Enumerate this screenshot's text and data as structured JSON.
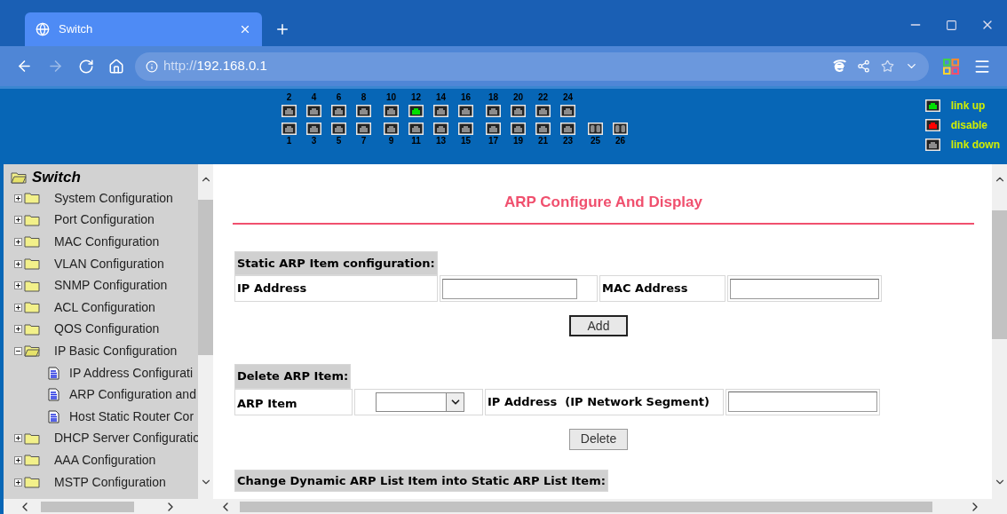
{
  "browser": {
    "tab": {
      "title": "Switch"
    },
    "url": {
      "scheme": "http://",
      "host": "192.168.0.1"
    }
  },
  "ports": {
    "groups": [
      {
        "kind": "copper",
        "columns": [
          {
            "top": {
              "label": "2",
              "link_up": false
            },
            "bottom": {
              "label": "1",
              "link_up": false
            }
          },
          {
            "top": {
              "label": "4",
              "link_up": false
            },
            "bottom": {
              "label": "3",
              "link_up": false
            }
          },
          {
            "top": {
              "label": "6",
              "link_up": false
            },
            "bottom": {
              "label": "5",
              "link_up": false
            }
          },
          {
            "top": {
              "label": "8",
              "link_up": false
            },
            "bottom": {
              "label": "7",
              "link_up": false
            }
          }
        ]
      },
      {
        "kind": "copper",
        "columns": [
          {
            "top": {
              "label": "10",
              "link_up": false
            },
            "bottom": {
              "label": "9",
              "link_up": false
            }
          },
          {
            "top": {
              "label": "12",
              "link_up": true
            },
            "bottom": {
              "label": "11",
              "link_up": false
            }
          },
          {
            "top": {
              "label": "14",
              "link_up": false
            },
            "bottom": {
              "label": "13",
              "link_up": false
            }
          },
          {
            "top": {
              "label": "16",
              "link_up": false
            },
            "bottom": {
              "label": "15",
              "link_up": false
            }
          }
        ]
      },
      {
        "kind": "copper",
        "columns": [
          {
            "top": {
              "label": "18",
              "link_up": false
            },
            "bottom": {
              "label": "17",
              "link_up": false
            }
          },
          {
            "top": {
              "label": "20",
              "link_up": false
            },
            "bottom": {
              "label": "19",
              "link_up": false
            }
          },
          {
            "top": {
              "label": "22",
              "link_up": false
            },
            "bottom": {
              "label": "21",
              "link_up": false
            }
          },
          {
            "top": {
              "label": "24",
              "link_up": false
            },
            "bottom": {
              "label": "23",
              "link_up": false
            }
          }
        ]
      },
      {
        "kind": "fiber",
        "columns": [
          {
            "bottom": {
              "label": "25",
              "link_up": false
            }
          },
          {
            "bottom": {
              "label": "26",
              "link_up": false
            }
          }
        ]
      }
    ],
    "legend": [
      {
        "color": "#00e000",
        "label": "link up"
      },
      {
        "color": "#ff0000",
        "label": "disable"
      },
      {
        "color": "#8c8c8c",
        "label": "link down"
      }
    ]
  },
  "sidebar": {
    "root": "Switch",
    "items": [
      {
        "label": "System Configuration",
        "expanded": false
      },
      {
        "label": "Port Configuration",
        "expanded": false
      },
      {
        "label": "MAC Configuration",
        "expanded": false
      },
      {
        "label": "VLAN Configuration",
        "expanded": false
      },
      {
        "label": "SNMP Configuration",
        "expanded": false
      },
      {
        "label": "ACL Configuration",
        "expanded": false
      },
      {
        "label": "QOS Configuration",
        "expanded": false
      },
      {
        "label": "IP Basic Configuration",
        "expanded": true,
        "children": [
          {
            "label": "IP Address Configurati"
          },
          {
            "label": "ARP Configuration and"
          },
          {
            "label": "Host Static Router Cor"
          }
        ]
      },
      {
        "label": "DHCP Server Configuratio",
        "expanded": false
      },
      {
        "label": "AAA Configuration",
        "expanded": false
      },
      {
        "label": "MSTP Configuration",
        "expanded": false
      }
    ]
  },
  "content": {
    "title": "ARP Configure And Display",
    "static_section": {
      "heading": "Static ARP Item configuration:",
      "ip_label": "IP Address",
      "mac_label": "MAC Address",
      "button": "Add"
    },
    "delete_section": {
      "heading": "Delete ARP Item:",
      "item_label": "ARP Item",
      "ip_label": "IP Address  (IP Network Segment)",
      "button": "Delete"
    },
    "next_section": {
      "heading": "Change Dynamic ARP List Item into Static ARP List Item:"
    }
  }
}
